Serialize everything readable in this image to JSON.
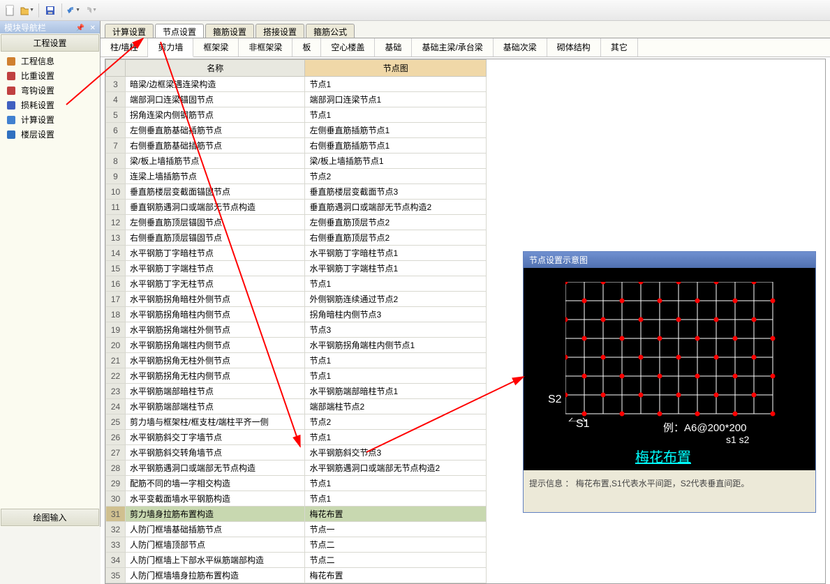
{
  "toolbar_icons": [
    "new-icon",
    "open-icon",
    "save-icon",
    "undo-icon",
    "redo-icon"
  ],
  "sidebar": {
    "title": "模块导航栏",
    "section": "工程设置",
    "items": [
      {
        "icon": "info-icon",
        "label": "工程信息",
        "color": "#d08030"
      },
      {
        "icon": "weight-icon",
        "label": "比重设置",
        "color": "#c04040"
      },
      {
        "icon": "bend-icon",
        "label": "弯钩设置",
        "color": "#c04040"
      },
      {
        "icon": "loss-icon",
        "label": "损耗设置",
        "color": "#4060c0"
      },
      {
        "icon": "calc-icon",
        "label": "计算设置",
        "color": "#4080d0"
      },
      {
        "icon": "floor-icon",
        "label": "楼层设置",
        "color": "#3070c0"
      }
    ],
    "footer": "绘图输入"
  },
  "top_tabs": [
    "计算设置",
    "节点设置",
    "箍筋设置",
    "搭接设置",
    "箍筋公式"
  ],
  "active_top_tab": 1,
  "sub_tabs": [
    "柱/墙柱",
    "剪力墙",
    "框架梁",
    "非框架梁",
    "板",
    "空心楼盖",
    "基础",
    "基础主梁/承台梁",
    "基础次梁",
    "砌体结构",
    "其它"
  ],
  "active_sub_tab": 1,
  "table": {
    "headers": [
      "名称",
      "节点图"
    ],
    "rows": [
      {
        "n": 3,
        "name": "暗梁/边框梁遇连梁构造",
        "val": "节点1"
      },
      {
        "n": 4,
        "name": "端部洞口连梁锚固节点",
        "val": "端部洞口连梁节点1"
      },
      {
        "n": 5,
        "name": "拐角连梁内侧钢筋节点",
        "val": "节点1"
      },
      {
        "n": 6,
        "name": "左侧垂直筋基础插筋节点",
        "val": "左侧垂直筋插筋节点1"
      },
      {
        "n": 7,
        "name": "右侧垂直筋基础插筋节点",
        "val": "右侧垂直筋插筋节点1"
      },
      {
        "n": 8,
        "name": "梁/板上墙插筋节点",
        "val": "梁/板上墙插筋节点1"
      },
      {
        "n": 9,
        "name": "连梁上墙插筋节点",
        "val": "节点2"
      },
      {
        "n": 10,
        "name": "垂直筋楼层变截面锚固节点",
        "val": "垂直筋楼层变截面节点3"
      },
      {
        "n": 11,
        "name": "垂直钢筋遇洞口或端部无节点构造",
        "val": "垂直筋遇洞口或端部无节点构造2"
      },
      {
        "n": 12,
        "name": "左侧垂直筋顶层锚固节点",
        "val": "左侧垂直筋顶层节点2"
      },
      {
        "n": 13,
        "name": "右侧垂直筋顶层锚固节点",
        "val": "右侧垂直筋顶层节点2"
      },
      {
        "n": 14,
        "name": "水平钢筋丁字暗柱节点",
        "val": "水平钢筋丁字暗柱节点1"
      },
      {
        "n": 15,
        "name": "水平钢筋丁字端柱节点",
        "val": "水平钢筋丁字端柱节点1"
      },
      {
        "n": 16,
        "name": "水平钢筋丁字无柱节点",
        "val": "节点1"
      },
      {
        "n": 17,
        "name": "水平钢筋拐角暗柱外侧节点",
        "val": "外侧钢筋连续通过节点2"
      },
      {
        "n": 18,
        "name": "水平钢筋拐角暗柱内侧节点",
        "val": "拐角暗柱内侧节点3"
      },
      {
        "n": 19,
        "name": "水平钢筋拐角端柱外侧节点",
        "val": "节点3"
      },
      {
        "n": 20,
        "name": "水平钢筋拐角端柱内侧节点",
        "val": "水平钢筋拐角端柱内侧节点1"
      },
      {
        "n": 21,
        "name": "水平钢筋拐角无柱外侧节点",
        "val": "节点1"
      },
      {
        "n": 22,
        "name": "水平钢筋拐角无柱内侧节点",
        "val": "节点1"
      },
      {
        "n": 23,
        "name": "水平钢筋端部暗柱节点",
        "val": "水平钢筋端部暗柱节点1"
      },
      {
        "n": 24,
        "name": "水平钢筋端部端柱节点",
        "val": "端部端柱节点2"
      },
      {
        "n": 25,
        "name": "剪力墙与框架柱/框支柱/端柱平齐一侧",
        "val": "节点2"
      },
      {
        "n": 26,
        "name": "水平钢筋斜交丁字墙节点",
        "val": "节点1"
      },
      {
        "n": 27,
        "name": "水平钢筋斜交转角墙节点",
        "val": "水平钢筋斜交节点3"
      },
      {
        "n": 28,
        "name": "水平钢筋遇洞口或端部无节点构造",
        "val": "水平钢筋遇洞口或端部无节点构造2"
      },
      {
        "n": 29,
        "name": "配筋不同的墙一字相交构造",
        "val": "节点1"
      },
      {
        "n": 30,
        "name": "水平变截面墙水平钢筋构造",
        "val": "节点1"
      },
      {
        "n": 31,
        "name": "剪力墙身拉筋布置构造",
        "val": "梅花布置",
        "selected": true
      },
      {
        "n": 32,
        "name": "人防门框墙基础插筋节点",
        "val": "节点一"
      },
      {
        "n": 33,
        "name": "人防门框墙顶部节点",
        "val": "节点二"
      },
      {
        "n": 34,
        "name": "人防门框墙上下部水平纵筋端部构造",
        "val": "节点二"
      },
      {
        "n": 35,
        "name": "人防门框墙墙身拉筋布置构造",
        "val": "梅花布置"
      }
    ]
  },
  "diagram": {
    "title": "节点设置示意图",
    "s1": "S1",
    "s2": "S2",
    "example": "例：A6@200*200",
    "s1s2": "s1   s2",
    "link": "梅花布置",
    "hint_label": "提示信息 ：",
    "hint_text": "梅花布置,S1代表水平间距，S2代表垂直间距。"
  }
}
